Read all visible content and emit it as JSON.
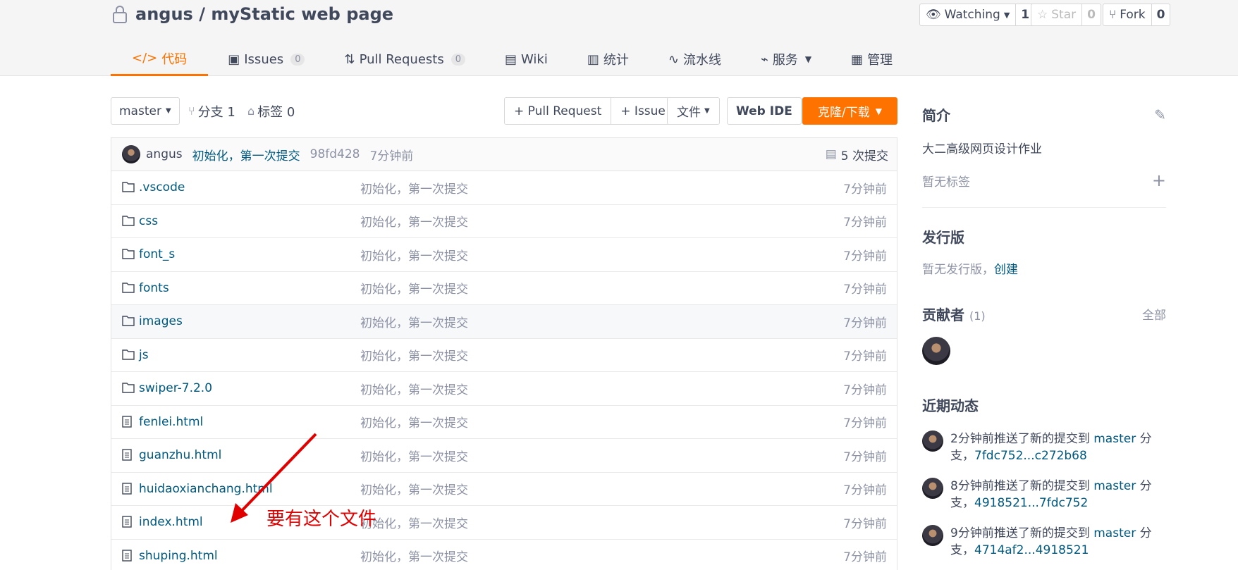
{
  "repo": {
    "owner": "angus",
    "sep": "/",
    "name": "myStatic web page"
  },
  "actions": {
    "watch": {
      "label": "Watching",
      "count": "1"
    },
    "star": {
      "label": "Star",
      "count": "0"
    },
    "fork": {
      "label": "Fork",
      "count": "0"
    }
  },
  "tabs": [
    {
      "label": "代码",
      "active": true
    },
    {
      "label": "Issues",
      "badge": "0"
    },
    {
      "label": "Pull Requests",
      "badge": "0"
    },
    {
      "label": "Wiki"
    },
    {
      "label": "统计"
    },
    {
      "label": "流水线"
    },
    {
      "label": "服务"
    },
    {
      "label": "管理"
    }
  ],
  "toolbar": {
    "branch": "master",
    "branches": "分支 1",
    "tags": "标签 0",
    "pull_request": "+ Pull Request",
    "issue": "+ Issue",
    "file": "文件",
    "web_ide": "Web IDE",
    "clone": "克隆/下载"
  },
  "last_commit": {
    "author": "angus",
    "message": "初始化，第一次提交",
    "sha": "98fd428",
    "time": "7分钟前",
    "commits": "5 次提交"
  },
  "files": [
    {
      "name": ".vscode",
      "type": "folder",
      "message": "初始化，第一次提交",
      "time": "7分钟前"
    },
    {
      "name": "css",
      "type": "folder",
      "message": "初始化，第一次提交",
      "time": "7分钟前"
    },
    {
      "name": "font_s",
      "type": "folder",
      "message": "初始化，第一次提交",
      "time": "7分钟前"
    },
    {
      "name": "fonts",
      "type": "folder",
      "message": "初始化，第一次提交",
      "time": "7分钟前"
    },
    {
      "name": "images",
      "type": "folder",
      "message": "初始化，第一次提交",
      "time": "7分钟前"
    },
    {
      "name": "js",
      "type": "folder",
      "message": "初始化，第一次提交",
      "time": "7分钟前"
    },
    {
      "name": "swiper-7.2.0",
      "type": "folder",
      "message": "初始化，第一次提交",
      "time": "7分钟前"
    },
    {
      "name": "fenlei.html",
      "type": "file",
      "message": "初始化，第一次提交",
      "time": "7分钟前"
    },
    {
      "name": "guanzhu.html",
      "type": "file",
      "message": "初始化，第一次提交",
      "time": "7分钟前"
    },
    {
      "name": "huidaoxianchang.html",
      "type": "file",
      "message": "初始化，第一次提交",
      "time": "7分钟前"
    },
    {
      "name": "index.html",
      "type": "file",
      "message": "初始化，第一次提交",
      "time": "7分钟前"
    },
    {
      "name": "shuping.html",
      "type": "file",
      "message": "初始化，第一次提交",
      "time": "7分钟前"
    }
  ],
  "annotation": "要有这个文件",
  "sidebar": {
    "intro_title": "简介",
    "intro_text": "大二高级网页设计作业",
    "no_tags": "暂无标签",
    "release_title": "发行版",
    "no_release": "暂无发行版，",
    "create": "创建",
    "contributors_title": "贡献者",
    "contributors_count": "(1)",
    "all": "全部",
    "activity_title": "近期动态",
    "activities": [
      {
        "prefix": "2分钟前推送了新的提交到 ",
        "branch": "master",
        "suffix": " 分支，",
        "range": "7fdc752...c272b68"
      },
      {
        "prefix": "8分钟前推送了新的提交到 ",
        "branch": "master",
        "suffix": " 分支，",
        "range": "4918521...7fdc752"
      },
      {
        "prefix": "9分钟前推送了新的提交到 ",
        "branch": "master",
        "suffix": " 分支，",
        "range": "4714af2...4918521"
      }
    ]
  },
  "colors": {
    "accent": "#fe7300",
    "link": "#005980",
    "text": "#40485b",
    "muted": "#8c92a4",
    "annotation": "#e00000"
  }
}
